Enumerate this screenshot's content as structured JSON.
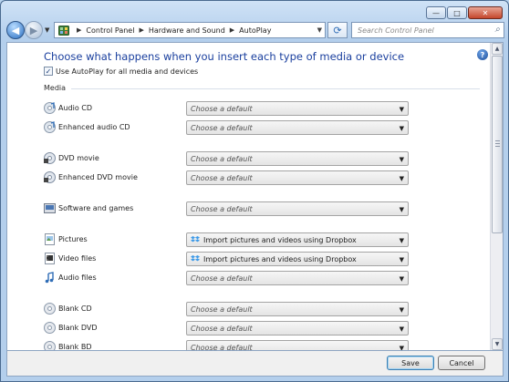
{
  "window": {
    "caption": {
      "minimize": "—",
      "maximize": "□",
      "close": "✕"
    }
  },
  "nav": {
    "back_glyph": "◀",
    "forward_glyph": "▶",
    "breadcrumb": [
      "Control Panel",
      "Hardware and Sound",
      "AutoPlay"
    ],
    "search_placeholder": "Search Control Panel"
  },
  "page": {
    "title": "Choose what happens when you insert each type of media or device",
    "autoplay_checkbox": {
      "label": "Use AutoPlay for all media and devices",
      "checked": true,
      "mark": "✓"
    },
    "section_label": "Media"
  },
  "media": [
    {
      "label": "Audio CD",
      "value": "Choose a default",
      "placeholder": true,
      "icon": "cd-audio-icon"
    },
    {
      "label": "Enhanced audio CD",
      "value": "Choose a default",
      "placeholder": true,
      "icon": "cd-audio-icon"
    },
    {
      "label": "DVD movie",
      "value": "Choose a default",
      "placeholder": true,
      "icon": "dvd-movie-icon"
    },
    {
      "label": "Enhanced DVD movie",
      "value": "Choose a default",
      "placeholder": true,
      "icon": "dvd-movie-icon"
    },
    {
      "label": "Software and games",
      "value": "Choose a default",
      "placeholder": true,
      "icon": "software-icon"
    },
    {
      "label": "Pictures",
      "value": "Import pictures and videos using Dropbox",
      "placeholder": false,
      "icon": "pictures-icon"
    },
    {
      "label": "Video files",
      "value": "Import pictures and videos using Dropbox",
      "placeholder": false,
      "icon": "video-files-icon"
    },
    {
      "label": "Audio files",
      "value": "Choose a default",
      "placeholder": true,
      "icon": "audio-files-icon"
    },
    {
      "label": "Blank CD",
      "value": "Choose a default",
      "placeholder": true,
      "icon": "blank-disc-icon"
    },
    {
      "label": "Blank DVD",
      "value": "Choose a default",
      "placeholder": true,
      "icon": "blank-disc-icon"
    },
    {
      "label": "Blank BD",
      "value": "Choose a default",
      "placeholder": true,
      "icon": "blank-disc-icon"
    }
  ],
  "footer": {
    "save_label": "Save",
    "cancel_label": "Cancel"
  },
  "colors": {
    "title_blue": "#1a3f9e",
    "dropbox_blue": "#3d9ae8"
  }
}
